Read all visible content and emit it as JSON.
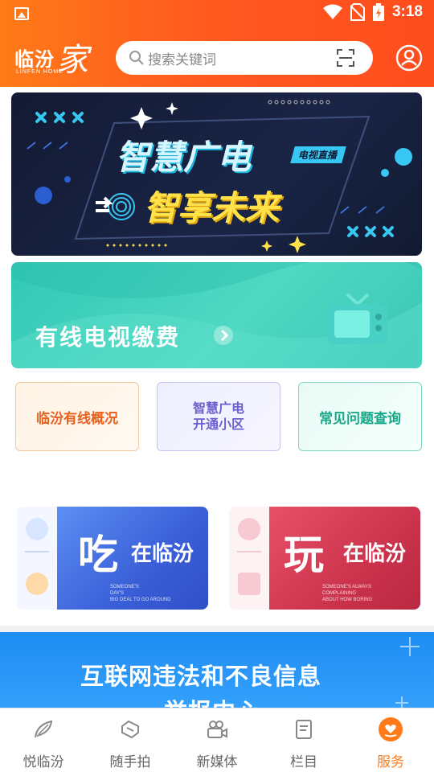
{
  "status_bar": {
    "time": "3:18"
  },
  "header": {
    "logo_text": "临汾",
    "logo_big": "家",
    "logo_en": "LINFEN HOME",
    "search_placeholder": "搜索关键词"
  },
  "banner": {
    "line1": "智慧广电",
    "line2": "智享未来",
    "tag": "电视直播"
  },
  "fee_banner": {
    "label": "有线电视缴费"
  },
  "tiles": [
    {
      "label": "临汾有线概况"
    },
    {
      "line1": "智慧广电",
      "line2": "开通小区"
    },
    {
      "label": "常见问题查询"
    }
  ],
  "cards": {
    "eat": {
      "big": "吃",
      "rest": "在临汾",
      "small1": "SOMEONE'S",
      "small2": "DAY'S",
      "small3": "BIG DEAL TO GO AROUND"
    },
    "play": {
      "big": "玩",
      "rest": "在临汾",
      "small1": "SOMEONE'S ALWAYS",
      "small2": "COMPLAINING",
      "small3": "ABOUT HOW BORING"
    }
  },
  "report": {
    "line1": "互联网违法和不良信息",
    "line2": "举报中心"
  },
  "nav": [
    {
      "label": "悦临汾",
      "icon": "feather-icon"
    },
    {
      "label": "随手拍",
      "icon": "shutter-icon"
    },
    {
      "label": "新媒体",
      "icon": "video-camera-icon"
    },
    {
      "label": "栏目",
      "icon": "column-icon"
    },
    {
      "label": "服务",
      "icon": "heart-hand-icon",
      "active": true
    }
  ],
  "colors": {
    "accent": "#ff7a18",
    "header_start": "#ff7a18",
    "header_end": "#ff4d1e"
  }
}
